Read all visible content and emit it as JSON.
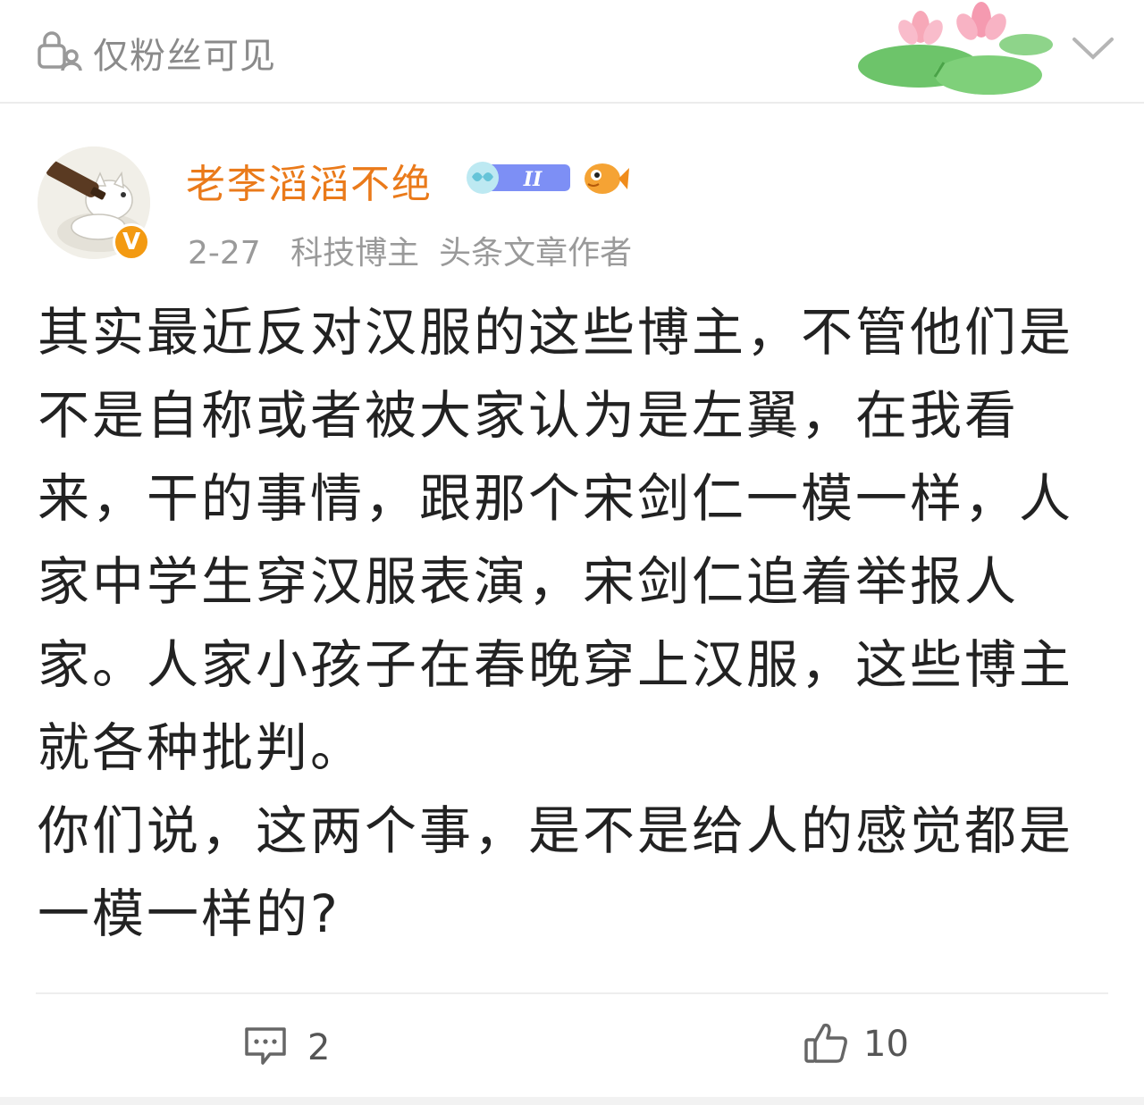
{
  "header": {
    "visibility_label": "仅粉丝可见",
    "lock_icon": "lock-person-icon",
    "decoration": "lotus-decoration",
    "collapse_icon": "chevron-down-icon"
  },
  "post": {
    "author": {
      "name": "老李滔滔不绝",
      "name_color": "#ea7a1a",
      "avatar": "cat-with-bottle-avatar",
      "verified_badge": "V",
      "level_badge": "II"
    },
    "meta": {
      "date": "2-27",
      "tag1": "科技博主",
      "tag2": "头条文章作者"
    },
    "content": {
      "paragraph1": "其实最近反对汉服的这些博主，不管他们是不是自称或者被大家认为是左翼，在我看来，干的事情，跟那个宋剑仁一模一样，人家中学生穿汉服表演，宋剑仁追着举报人家。人家小孩子在春晚穿上汉服，这些博主就各种批判。",
      "paragraph2": "你们说，这两个事，是不是给人的感觉都是一模一样的?"
    }
  },
  "actions": {
    "comment_count": "2",
    "like_count": "10"
  }
}
